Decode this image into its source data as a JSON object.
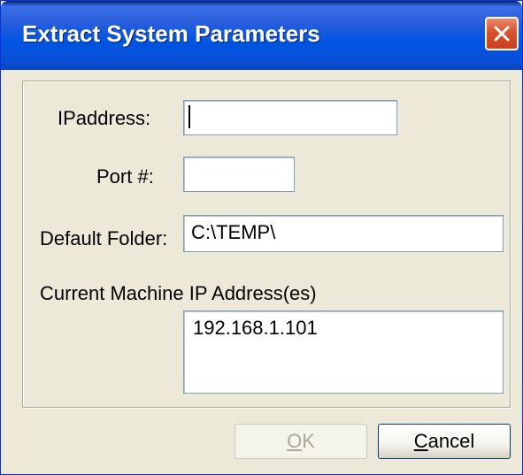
{
  "window": {
    "title": "Extract System Parameters"
  },
  "form": {
    "ip_label": "IPaddress:",
    "ip_value": "",
    "port_label": "Port #:",
    "port_value": "",
    "folder_label": "Default Folder:",
    "folder_value": "C:\\TEMP\\",
    "machine_ip_label": "Current Machine IP Address(es)",
    "machine_ip_value": "192.168.1.101"
  },
  "buttons": {
    "ok_mnemonic": "O",
    "ok_rest": "K",
    "ok_enabled": false,
    "cancel_mnemonic": "C",
    "cancel_rest": "ancel"
  },
  "colors": {
    "titlebar": "#0054e3",
    "window_bg": "#ece9d8",
    "close_button": "#d9512e"
  },
  "icons": {
    "close": "close-icon"
  }
}
